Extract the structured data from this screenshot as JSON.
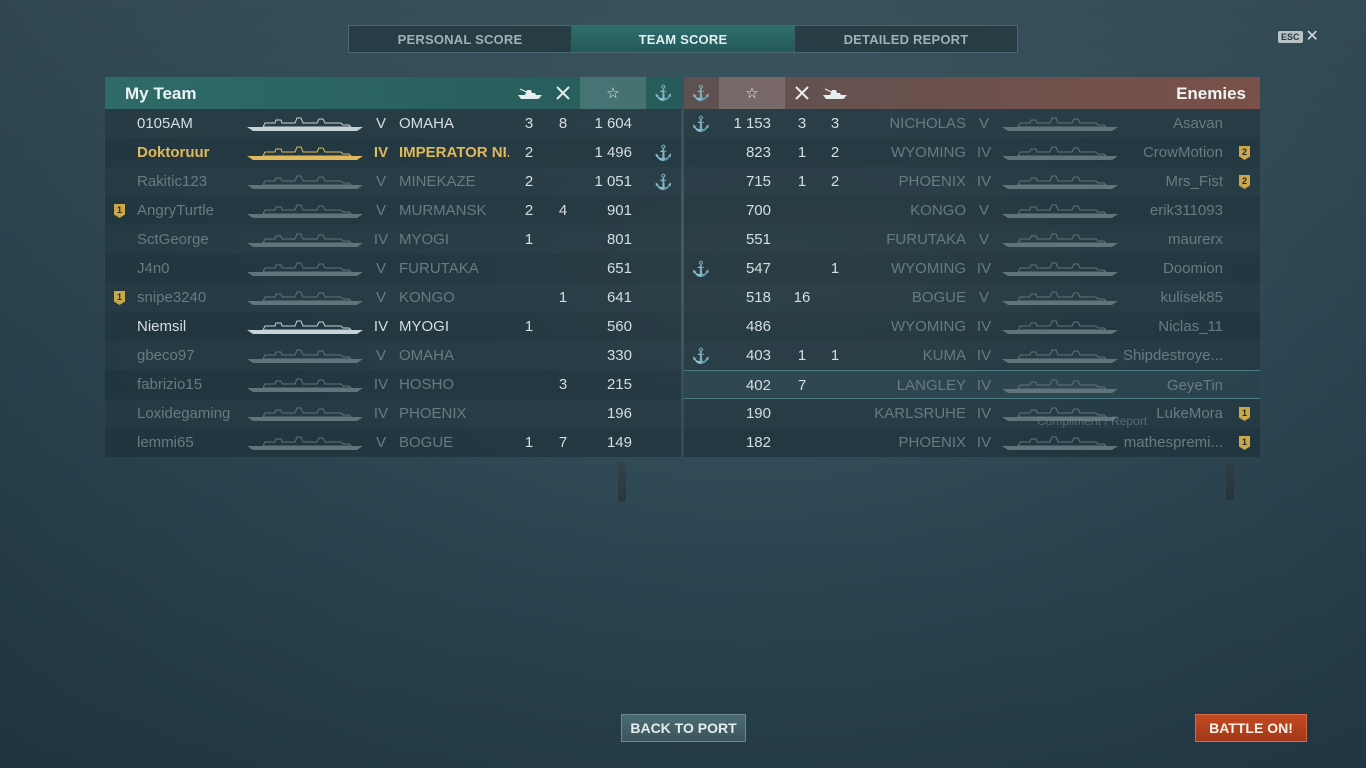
{
  "tabs": [
    {
      "label": "PERSONAL SCORE",
      "active": false
    },
    {
      "label": "TEAM SCORE",
      "active": true
    },
    {
      "label": "DETAILED REPORT",
      "active": false
    }
  ],
  "esc_label": "ESC",
  "my_team": {
    "title": "My Team",
    "rows": [
      {
        "player": "0105AM",
        "tier": "V",
        "ship": "OMAHA",
        "c1": "3",
        "c2": "8",
        "score": "1 604",
        "anchor": false,
        "badge": "",
        "style": "bright"
      },
      {
        "player": "Doktoruur",
        "tier": "IV",
        "ship": "IMPERATOR NI...",
        "c1": "2",
        "c2": "",
        "score": "1 496",
        "anchor": true,
        "badge": "",
        "style": "gold"
      },
      {
        "player": "Rakitic123",
        "tier": "V",
        "ship": "MINEKAZE",
        "c1": "2",
        "c2": "",
        "score": "1 051",
        "anchor": true,
        "badge": "",
        "style": "dim"
      },
      {
        "player": "AngryTurtle",
        "tier": "V",
        "ship": "MURMANSK",
        "c1": "2",
        "c2": "4",
        "score": "901",
        "anchor": false,
        "badge": "1",
        "style": "dim"
      },
      {
        "player": "SctGeorge",
        "tier": "IV",
        "ship": "MYOGI",
        "c1": "1",
        "c2": "",
        "score": "801",
        "anchor": false,
        "badge": "",
        "style": "dim"
      },
      {
        "player": "J4n0",
        "tier": "V",
        "ship": "FURUTAKA",
        "c1": "",
        "c2": "",
        "score": "651",
        "anchor": false,
        "badge": "",
        "style": "dim"
      },
      {
        "player": "snipe3240",
        "tier": "V",
        "ship": "KONGO",
        "c1": "",
        "c2": "1",
        "score": "641",
        "anchor": false,
        "badge": "1",
        "style": "dim"
      },
      {
        "player": "Niemsil",
        "tier": "IV",
        "ship": "MYOGI",
        "c1": "1",
        "c2": "",
        "score": "560",
        "anchor": false,
        "badge": "",
        "style": "bright"
      },
      {
        "player": "gbeco97",
        "tier": "V",
        "ship": "OMAHA",
        "c1": "",
        "c2": "",
        "score": "330",
        "anchor": false,
        "badge": "",
        "style": "dim"
      },
      {
        "player": "fabrizio15",
        "tier": "IV",
        "ship": "HOSHO",
        "c1": "",
        "c2": "3",
        "score": "215",
        "anchor": false,
        "badge": "",
        "style": "dim"
      },
      {
        "player": "Loxidegaming",
        "tier": "IV",
        "ship": "PHOENIX",
        "c1": "",
        "c2": "",
        "score": "196",
        "anchor": false,
        "badge": "",
        "style": "dim"
      },
      {
        "player": "lemmi65",
        "tier": "V",
        "ship": "BOGUE",
        "c1": "1",
        "c2": "7",
        "score": "149",
        "anchor": false,
        "badge": "",
        "style": "dim"
      }
    ]
  },
  "enemies": {
    "title": "Enemies",
    "rows": [
      {
        "player": "Asavan",
        "tier": "V",
        "ship": "NICHOLAS",
        "c1": "3",
        "c2": "3",
        "score": "1 153",
        "anchor": true,
        "badge": ""
      },
      {
        "player": "CrowMotion",
        "tier": "IV",
        "ship": "WYOMING",
        "c1": "1",
        "c2": "2",
        "score": "823",
        "anchor": false,
        "badge": "2"
      },
      {
        "player": "Mrs_Fist",
        "tier": "IV",
        "ship": "PHOENIX",
        "c1": "1",
        "c2": "2",
        "score": "715",
        "anchor": false,
        "badge": "2"
      },
      {
        "player": "erik311093",
        "tier": "V",
        "ship": "KONGO",
        "c1": "",
        "c2": "",
        "score": "700",
        "anchor": false,
        "badge": ""
      },
      {
        "player": "maurerx",
        "tier": "V",
        "ship": "FURUTAKA",
        "c1": "",
        "c2": "",
        "score": "551",
        "anchor": false,
        "badge": ""
      },
      {
        "player": "Doomion",
        "tier": "IV",
        "ship": "WYOMING",
        "c1": "",
        "c2": "1",
        "score": "547",
        "anchor": true,
        "badge": ""
      },
      {
        "player": "kulisek85",
        "tier": "V",
        "ship": "BOGUE",
        "c1": "16",
        "c2": "",
        "score": "518",
        "anchor": false,
        "badge": ""
      },
      {
        "player": "Niclas_11",
        "tier": "IV",
        "ship": "WYOMING",
        "c1": "",
        "c2": "",
        "score": "486",
        "anchor": false,
        "badge": ""
      },
      {
        "player": "Shipdestroye...",
        "tier": "IV",
        "ship": "KUMA",
        "c1": "1",
        "c2": "1",
        "score": "403",
        "anchor": true,
        "badge": ""
      },
      {
        "player": "GeyeTin",
        "tier": "IV",
        "ship": "LANGLEY",
        "c1": "7",
        "c2": "",
        "score": "402",
        "anchor": false,
        "badge": "",
        "highlight": true
      },
      {
        "player": "LukeMora",
        "tier": "IV",
        "ship": "KARLSRUHE",
        "c1": "",
        "c2": "",
        "score": "190",
        "anchor": false,
        "badge": "1"
      },
      {
        "player": "mathespremi...",
        "tier": "IV",
        "ship": "PHOENIX",
        "c1": "",
        "c2": "",
        "score": "182",
        "anchor": false,
        "badge": "1"
      }
    ]
  },
  "hover_text": "Compliment / Report",
  "buttons": {
    "back_to_port": "BACK TO PORT",
    "battle_on": "BATTLE ON!"
  },
  "icons": {
    "ships_destroyed": "ship-kill-icon",
    "planes_destroyed": "plane-kill-icon",
    "score": "star-icon",
    "base_capture": "anchor-icon"
  },
  "colors": {
    "my_team_header": "#2e6b68",
    "enemy_header": "#7a5048",
    "player_highlight": "#e0b95a",
    "battle_button": "#c24a22"
  }
}
